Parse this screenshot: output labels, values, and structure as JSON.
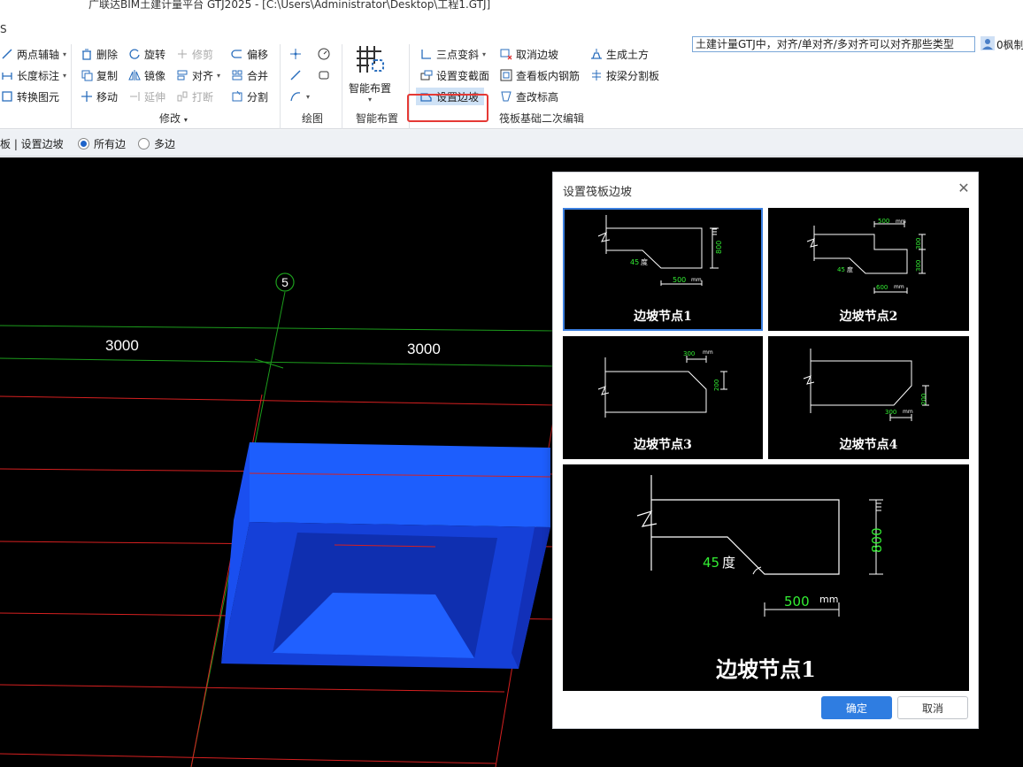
{
  "window": {
    "title": "广联达BIM土建计量平台 GTJ2025 - [C:\\Users\\Administrator\\Desktop\\工程1.GTJ]"
  },
  "ribbon": {
    "tab_fragment": "S",
    "aux": [
      {
        "label": "两点辅轴"
      },
      {
        "label": "长度标注"
      },
      {
        "label": "转换图元"
      }
    ],
    "modify": {
      "group": "修改",
      "items": [
        {
          "label": "删除"
        },
        {
          "label": "旋转"
        },
        {
          "label": "修剪"
        },
        {
          "label": "偏移"
        },
        {
          "label": "复制"
        },
        {
          "label": "镜像"
        },
        {
          "label": "对齐"
        },
        {
          "label": "合并"
        },
        {
          "label": "移动"
        },
        {
          "label": "延伸"
        },
        {
          "label": "打断"
        },
        {
          "label": "分割"
        }
      ]
    },
    "draw": {
      "group": "绘图"
    },
    "smart": {
      "label": "智能布置",
      "group": "智能布置"
    },
    "raft": {
      "group": "筏板基础二次编辑",
      "items": [
        {
          "label": "三点变斜"
        },
        {
          "label": "取消边坡"
        },
        {
          "label": "生成土方"
        },
        {
          "label": "设置变截面"
        },
        {
          "label": "查看板内钢筋"
        },
        {
          "label": "按梁分割板"
        },
        {
          "label": "设置边坡"
        },
        {
          "label": "查改标高"
        }
      ]
    },
    "search": {
      "value": "土建计量GTJ中，对齐/单对齐/多对齐可以对齐那些类型"
    },
    "user": {
      "name": "0枫制"
    }
  },
  "optionbar": {
    "crumb": "板 | 设置边坡",
    "radio_all": "所有边",
    "radio_multi": "多边"
  },
  "canvas": {
    "axis_label": "5",
    "dim1": "3000",
    "dim2": "3000"
  },
  "dialog": {
    "title": "设置筏板边坡",
    "tiles": [
      {
        "caption": "边坡节点1",
        "angle": "45",
        "angle_unit": "度",
        "h": "800",
        "w": "500",
        "unit": "mm"
      },
      {
        "caption": "边坡节点2",
        "top_w": "500",
        "angle": "45",
        "angle_unit": "度",
        "h1": "300",
        "h2": "300",
        "w": "600",
        "unit": "mm"
      },
      {
        "caption": "边坡节点3",
        "w": "300",
        "h": "200",
        "unit": "mm"
      },
      {
        "caption": "边坡节点4",
        "w": "300",
        "h": "200",
        "unit": "mm"
      }
    ],
    "preview": {
      "caption": "边坡节点1",
      "angle": "45",
      "angle_unit": "度",
      "h": "800",
      "w": "500",
      "unit": "mm"
    },
    "ok": "确定",
    "cancel": "取消"
  },
  "colors": {
    "selection_border": "#3b7fe0",
    "highlight_box": "#e53935",
    "slab_blue": "#1f5fff",
    "dim_green": "#22dd22"
  }
}
